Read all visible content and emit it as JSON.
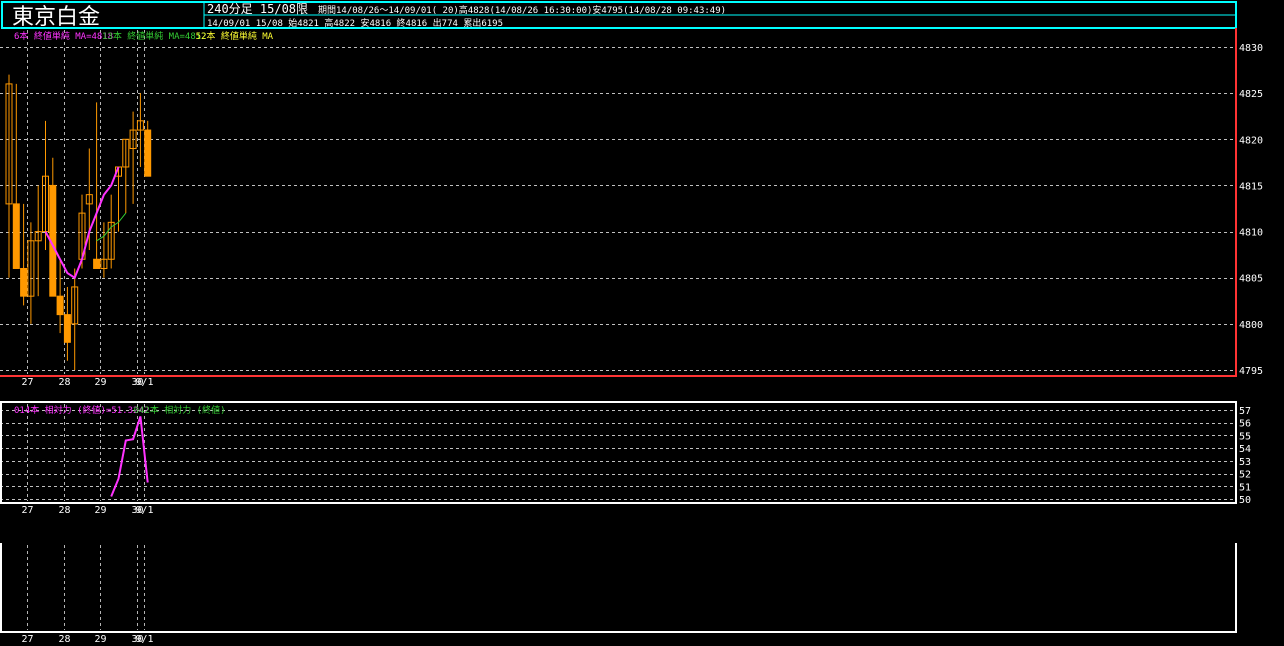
{
  "header": {
    "instrument": "東京白金",
    "timeframe": "240分足 15/08限",
    "period_info": "期間14/08/26～14/09/01( 20)高4828(14/08/26 16:30:00)安4795(14/08/28 09:43:49)",
    "latest_bar": "14/09/01 15/08 始4821 高4822 安4816 終4816 出774 累出6195"
  },
  "colors": {
    "background": "#000000",
    "candle": "#ff9900",
    "ma_short": "#ff33ff",
    "ma_mid": "#33cc33",
    "ma_long": "#ffff33",
    "grid": "#ffffff",
    "frame": "#ffffff",
    "frame_active": "#ff3333",
    "title_border": "#00ffff"
  },
  "chart_data": [
    {
      "type": "candlestick",
      "panel": "price",
      "legend": [
        {
          "text": "6本 終値単純 MA=4818",
          "color": "#ff33ff"
        },
        {
          "text": "13本 終値単純 MA=4812",
          "color": "#33cc33"
        },
        {
          "text": "52本 終値単純 MA",
          "color": "#ffff33"
        }
      ],
      "ylim": [
        4795,
        4832
      ],
      "yticks": [
        4795,
        4800,
        4805,
        4810,
        4815,
        4820,
        4825,
        4830
      ],
      "x_labels": [
        "27",
        "28",
        "29",
        "30",
        "9/1"
      ],
      "day_boundaries_after_bar": [
        2,
        7,
        12,
        17,
        18
      ],
      "candles": [
        {
          "o": 4813,
          "h": 4827,
          "l": 4805,
          "c": 4826
        },
        {
          "o": 4813,
          "h": 4826,
          "l": 4806,
          "c": 4806
        },
        {
          "o": 4806,
          "h": 4813,
          "l": 4802,
          "c": 4803
        },
        {
          "o": 4803,
          "h": 4811,
          "l": 4800,
          "c": 4809
        },
        {
          "o": 4809,
          "h": 4815,
          "l": 4803,
          "c": 4810
        },
        {
          "o": 4810,
          "h": 4822,
          "l": 4808,
          "c": 4816
        },
        {
          "o": 4815,
          "h": 4818,
          "l": 4803,
          "c": 4803
        },
        {
          "o": 4803,
          "h": 4807,
          "l": 4799,
          "c": 4801
        },
        {
          "o": 4801,
          "h": 4804,
          "l": 4796,
          "c": 4798
        },
        {
          "o": 4800,
          "h": 4806,
          "l": 4795,
          "c": 4804
        },
        {
          "o": 4807,
          "h": 4814,
          "l": 4806,
          "c": 4812
        },
        {
          "o": 4813,
          "h": 4819,
          "l": 4808,
          "c": 4814
        },
        {
          "o": 4807,
          "h": 4824,
          "l": 4806,
          "c": 4806
        },
        {
          "o": 4806,
          "h": 4811,
          "l": 4805,
          "c": 4807
        },
        {
          "o": 4807,
          "h": 4814,
          "l": 4806,
          "c": 4811
        },
        {
          "o": 4816,
          "h": 4817,
          "l": 4810,
          "c": 4817
        },
        {
          "o": 4817,
          "h": 4820,
          "l": 4812,
          "c": 4820
        },
        {
          "o": 4819,
          "h": 4823,
          "l": 4813,
          "c": 4821
        },
        {
          "o": 4821,
          "h": 4825,
          "l": 4817,
          "c": 4822
        },
        {
          "o": 4821,
          "h": 4822,
          "l": 4816,
          "c": 4816
        }
      ],
      "series": [
        {
          "name": "6本 終値単純 MA",
          "color": "#ff33ff",
          "start_bar": 5,
          "values": [
            4810,
            4808.5,
            4807,
            4805.5,
            4805,
            4807,
            4810,
            4812,
            4814,
            4815,
            4817
          ]
        },
        {
          "name": "13本 終値単純 MA",
          "color": "#33cc33",
          "start_bar": 12,
          "values": [
            4809,
            4809.5,
            4810.5,
            4811,
            4812
          ]
        }
      ]
    },
    {
      "type": "line",
      "panel": "oscillator",
      "legend": [
        {
          "text": "014本 相対力 (終値)=51.3242",
          "color": "#ff33ff"
        },
        {
          "text": "042本 相対力 (終値)",
          "color": "#33cc33"
        }
      ],
      "ylim": [
        50,
        57
      ],
      "yticks": [
        50,
        51,
        52,
        53,
        54,
        55,
        56,
        57
      ],
      "x_labels": [
        "27",
        "28",
        "29",
        "30",
        "9/1"
      ],
      "series": [
        {
          "name": "014本 相対力 (終値)",
          "color": "#ff33ff",
          "start_bar": 14,
          "values": [
            50.2,
            51.6,
            54.6,
            54.7,
            56.5,
            51.3
          ]
        }
      ]
    },
    {
      "type": "line",
      "panel": "empty",
      "x_labels": [
        "27",
        "28",
        "29",
        "30",
        "9/1"
      ],
      "series": []
    }
  ]
}
